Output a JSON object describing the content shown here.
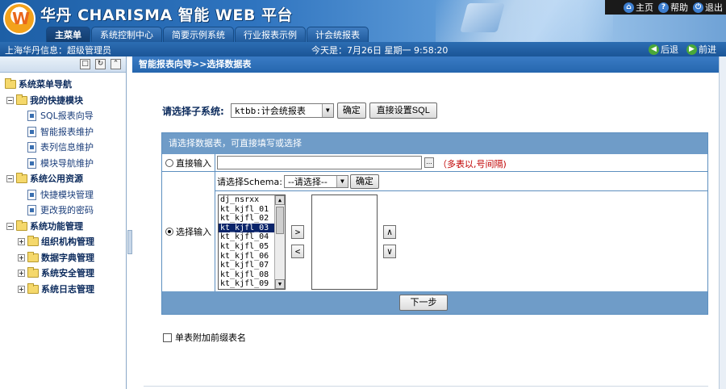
{
  "header": {
    "logo_char": "W",
    "brand": "华丹 CHARISMA 智能 WEB 平台",
    "top_links": [
      {
        "label": "主页",
        "icon": "home-icon",
        "color": "#2b6cc0"
      },
      {
        "label": "帮助",
        "icon": "help-icon",
        "color": "#2b6cc0"
      },
      {
        "label": "退出",
        "icon": "exit-icon",
        "color": "#2b6cc0"
      }
    ],
    "tabs": [
      "主菜单",
      "系统控制中心",
      "简要示例系统",
      "行业报表示例",
      "计会统报表"
    ]
  },
  "statusbar": {
    "user": "上海华丹信息：超级管理员",
    "date": "今天是：7月26日 星期一  9:58:20",
    "back": "后退",
    "forward": "前进"
  },
  "sidebar": {
    "tools": [
      "□",
      "↻",
      "⌃"
    ],
    "tree": {
      "root": "系统菜单导航",
      "groups": [
        {
          "label": "我的快捷模块",
          "expanded": true,
          "items": [
            "SQL报表向导",
            "智能报表维护",
            "表列信息维护",
            "模块导航维护"
          ]
        },
        {
          "label": "系统公用资源",
          "expanded": true,
          "items": [
            "快捷模块管理",
            "更改我的密码"
          ]
        },
        {
          "label": "系统功能管理",
          "expanded": true,
          "children": [
            "组织机构管理",
            "数据字典管理",
            "系统安全管理",
            "系统日志管理"
          ]
        }
      ]
    }
  },
  "main": {
    "breadcrumb": "智能报表向导>>选择数据表",
    "subsystem_label": "请选择子系统:",
    "subsystem_value": "ktbb:计会统报表",
    "confirm": "确定",
    "direct_sql": "直接设置SQL",
    "panel_title": "请选择数据表，可直接填写或选择",
    "direct_input_label": "直接输入",
    "direct_input_value": "",
    "browse_btn": "...",
    "direct_hint": "（多表以,号间隔)",
    "schema_label": "请选择Schema:",
    "schema_value": "--请选择--",
    "schema_confirm": "确定",
    "select_input_label": "选择输入",
    "tables": [
      "dj_nsrxx",
      "kt_kjfl_01",
      "kt_kjfl_02",
      "kt_kjfl_03",
      "kt_kjfl_04",
      "kt_kjfl_05",
      "kt_kjfl_06",
      "kt_kjfl_07",
      "kt_kjfl_08",
      "kt_kjfl_09"
    ],
    "selected_table": "kt_kjfl_03",
    "move_right": ">",
    "move_left": "<",
    "move_up": "∧",
    "move_down": "∨",
    "next": "下一步",
    "prefix_checkbox": "单表附加前缀表名"
  }
}
